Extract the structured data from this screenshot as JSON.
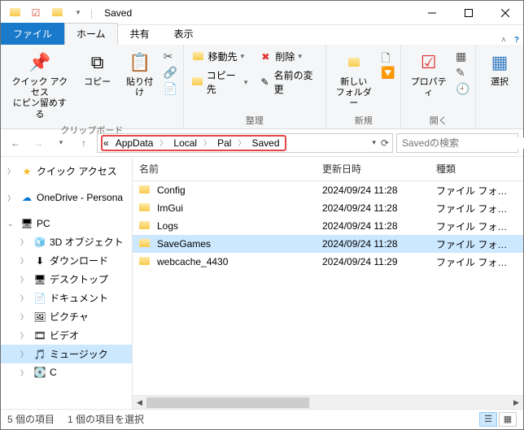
{
  "window": {
    "title": "Saved"
  },
  "tabs": {
    "file": "ファイル",
    "home": "ホーム",
    "share": "共有",
    "view": "表示"
  },
  "ribbon": {
    "clipboard": {
      "label": "クリップボード",
      "pin": "クイック アクセス\nにピン留めする",
      "copy": "コピー",
      "paste": "貼り付け"
    },
    "organize": {
      "label": "整理",
      "moveto": "移動先",
      "copyto": "コピー先",
      "delete": "削除",
      "rename": "名前の変更"
    },
    "new": {
      "label": "新規",
      "newfolder": "新しい\nフォルダー"
    },
    "open": {
      "label": "開く",
      "properties": "プロパティ"
    },
    "select": {
      "label": "",
      "select": "選択"
    }
  },
  "breadcrumb": {
    "lead": "«",
    "parts": [
      "AppData",
      "Local",
      "Pal",
      "Saved"
    ]
  },
  "search": {
    "placeholder": "Savedの検索"
  },
  "tree": {
    "quick": "クイック アクセス",
    "onedrive": "OneDrive - Persona",
    "pc": "PC",
    "items": [
      "3D オブジェクト",
      "ダウンロード",
      "デスクトップ",
      "ドキュメント",
      "ピクチャ",
      "ビデオ",
      "ミュージック",
      "C"
    ]
  },
  "columns": {
    "name": "名前",
    "date": "更新日時",
    "type": "種類"
  },
  "rows": [
    {
      "name": "Config",
      "date": "2024/09/24 11:28",
      "type": "ファイル フォルダー",
      "sel": false
    },
    {
      "name": "ImGui",
      "date": "2024/09/24 11:28",
      "type": "ファイル フォルダー",
      "sel": false
    },
    {
      "name": "Logs",
      "date": "2024/09/24 11:28",
      "type": "ファイル フォルダー",
      "sel": false
    },
    {
      "name": "SaveGames",
      "date": "2024/09/24 11:28",
      "type": "ファイル フォルダー",
      "sel": true
    },
    {
      "name": "webcache_4430",
      "date": "2024/09/24 11:29",
      "type": "ファイル フォルダー",
      "sel": false
    }
  ],
  "status": {
    "count": "5 個の項目",
    "selected": "1 個の項目を選択"
  }
}
